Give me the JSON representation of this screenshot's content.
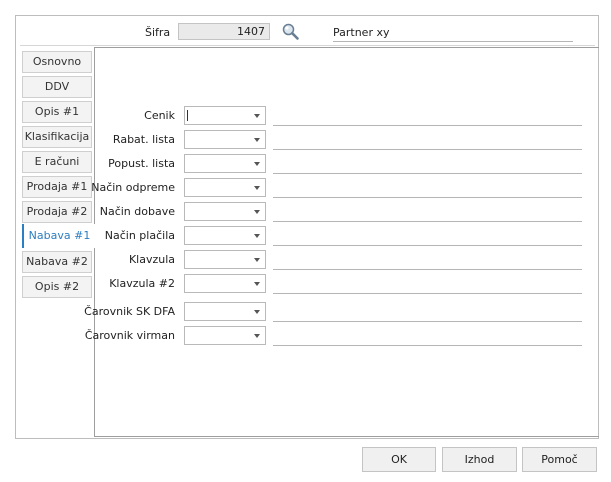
{
  "header": {
    "sifra_label": "Šifra",
    "sifra_value": "1407",
    "partner_value": "Partner xy"
  },
  "tabs": [
    {
      "label": "Osnovno",
      "active": false
    },
    {
      "label": "DDV",
      "active": false
    },
    {
      "label": "Opis #1",
      "active": false
    },
    {
      "label": "Klasifikacija",
      "active": false
    },
    {
      "label": "E računi",
      "active": false
    },
    {
      "label": "Prodaja #1",
      "active": false
    },
    {
      "label": "Prodaja #2",
      "active": false
    },
    {
      "label": "Nabava #1",
      "active": true
    },
    {
      "label": "Nabava #2",
      "active": false
    },
    {
      "label": "Opis #2",
      "active": false
    }
  ],
  "fields": [
    {
      "label": "Cenik",
      "value": ""
    },
    {
      "label": "Rabat. lista",
      "value": ""
    },
    {
      "label": "Popust. lista",
      "value": ""
    },
    {
      "label": "Način odpreme",
      "value": ""
    },
    {
      "label": "Način dobave",
      "value": ""
    },
    {
      "label": "Način plačila",
      "value": ""
    },
    {
      "label": "Klavzula",
      "value": ""
    },
    {
      "label": "Klavzula #2",
      "value": ""
    },
    {
      "label": "Čarovnik SK DFA",
      "value": ""
    },
    {
      "label": "Čarovnik virman",
      "value": ""
    }
  ],
  "buttons": {
    "ok": "OK",
    "exit": "Izhod",
    "help": "Pomoč"
  },
  "colors": {
    "accent": "#2b7ec1",
    "tab_bg": "#f3f3f3",
    "readonly_bg": "#eaeaea"
  },
  "icons": {
    "search": "search-icon"
  }
}
